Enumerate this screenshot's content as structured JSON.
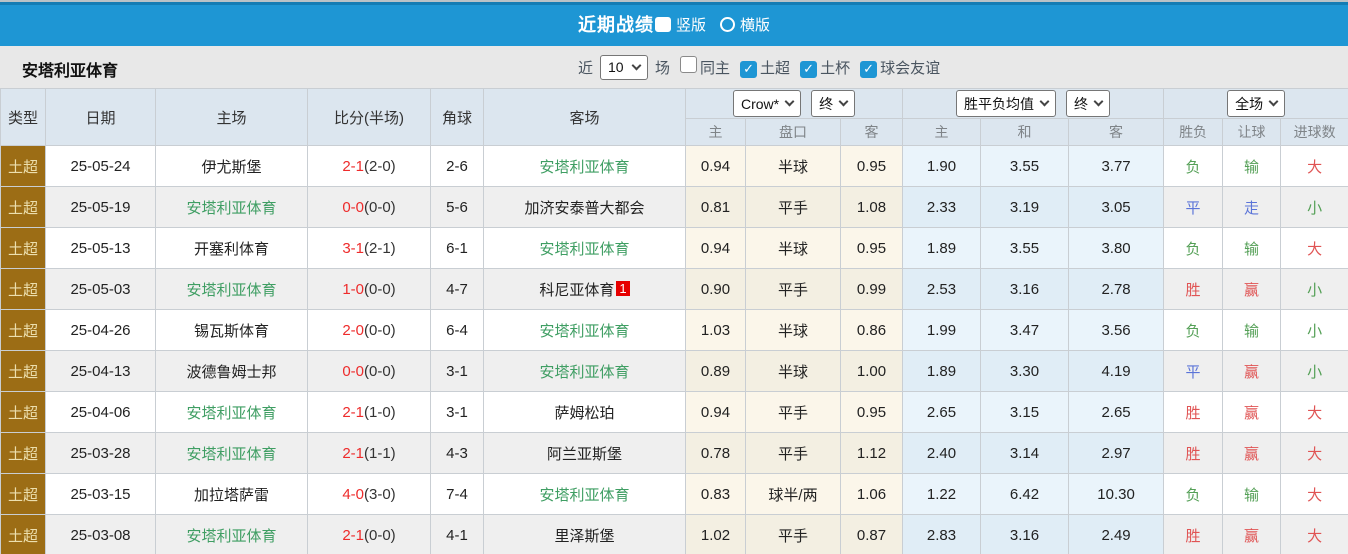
{
  "title_bar": {
    "title": "近期战绩",
    "radio_vertical": "竖版",
    "radio_horizontal": "横版"
  },
  "filter_bar": {
    "team_name": "安塔利亚体育",
    "near_label": "近",
    "match_count": "10",
    "games_label": "场",
    "checkboxes": [
      {
        "label": "同主",
        "checked": false
      },
      {
        "label": "土超",
        "checked": true
      },
      {
        "label": "土杯",
        "checked": true
      },
      {
        "label": "球会友谊",
        "checked": true
      }
    ]
  },
  "icons": {
    "checkmark": "✓",
    "chevron_down": "chevron-down"
  },
  "colors": {
    "accent_blue": "#1e96d4",
    "type_cell_bg": "#9c6d15",
    "team_green": "#3f9e63",
    "score_red": "#ee2b2b",
    "win_red": "#e05454",
    "draw_blue": "#5b74d8",
    "loss_green": "#55a057",
    "badge_red": "#e60000"
  },
  "table": {
    "static_headers": [
      "类型",
      "日期",
      "主场",
      "比分(半场)",
      "角球",
      "客场"
    ],
    "group1": {
      "select1": "Crow*",
      "select2": "终",
      "subheaders": [
        "主",
        "盘口",
        "客"
      ]
    },
    "group2": {
      "select1": "胜平负均值",
      "select2": "终",
      "subheaders": [
        "主",
        "和",
        "客"
      ]
    },
    "group3": {
      "select": "全场",
      "subheaders": [
        "胜负",
        "让球",
        "进球数"
      ]
    },
    "rows": [
      {
        "type": "土超",
        "date": "25-05-24",
        "home": "伊尤斯堡",
        "score_ft": "2-1",
        "score_ht": "(2-0)",
        "corner": "2-6",
        "away": "安塔利亚体育",
        "away_badge": "",
        "asian": [
          "0.94",
          "半球",
          "0.95"
        ],
        "euro": [
          "1.90",
          "3.55",
          "3.77"
        ],
        "results": [
          {
            "t": "负",
            "c": "green"
          },
          {
            "t": "输",
            "c": "green"
          },
          {
            "t": "大",
            "c": "red"
          }
        ]
      },
      {
        "type": "土超",
        "date": "25-05-19",
        "home": "安塔利亚体育",
        "score_ft": "0-0",
        "score_ht": "(0-0)",
        "corner": "5-6",
        "away": "加济安泰普大都会",
        "away_badge": "",
        "asian": [
          "0.81",
          "平手",
          "1.08"
        ],
        "euro": [
          "2.33",
          "3.19",
          "3.05"
        ],
        "results": [
          {
            "t": "平",
            "c": "blue"
          },
          {
            "t": "走",
            "c": "blue"
          },
          {
            "t": "小",
            "c": "green"
          }
        ]
      },
      {
        "type": "土超",
        "date": "25-05-13",
        "home": "开塞利体育",
        "score_ft": "3-1",
        "score_ht": "(2-1)",
        "corner": "6-1",
        "away": "安塔利亚体育",
        "away_badge": "",
        "asian": [
          "0.94",
          "半球",
          "0.95"
        ],
        "euro": [
          "1.89",
          "3.55",
          "3.80"
        ],
        "results": [
          {
            "t": "负",
            "c": "green"
          },
          {
            "t": "输",
            "c": "green"
          },
          {
            "t": "大",
            "c": "red"
          }
        ]
      },
      {
        "type": "土超",
        "date": "25-05-03",
        "home": "安塔利亚体育",
        "score_ft": "1-0",
        "score_ht": "(0-0)",
        "corner": "4-7",
        "away": "科尼亚体育",
        "away_badge": "1",
        "asian": [
          "0.90",
          "平手",
          "0.99"
        ],
        "euro": [
          "2.53",
          "3.16",
          "2.78"
        ],
        "results": [
          {
            "t": "胜",
            "c": "red"
          },
          {
            "t": "赢",
            "c": "red"
          },
          {
            "t": "小",
            "c": "green"
          }
        ]
      },
      {
        "type": "土超",
        "date": "25-04-26",
        "home": "锡瓦斯体育",
        "score_ft": "2-0",
        "score_ht": "(0-0)",
        "corner": "6-4",
        "away": "安塔利亚体育",
        "away_badge": "",
        "asian": [
          "1.03",
          "半球",
          "0.86"
        ],
        "euro": [
          "1.99",
          "3.47",
          "3.56"
        ],
        "results": [
          {
            "t": "负",
            "c": "green"
          },
          {
            "t": "输",
            "c": "green"
          },
          {
            "t": "小",
            "c": "green"
          }
        ]
      },
      {
        "type": "土超",
        "date": "25-04-13",
        "home": "波德鲁姆士邦",
        "score_ft": "0-0",
        "score_ht": "(0-0)",
        "corner": "3-1",
        "away": "安塔利亚体育",
        "away_badge": "",
        "asian": [
          "0.89",
          "半球",
          "1.00"
        ],
        "euro": [
          "1.89",
          "3.30",
          "4.19"
        ],
        "results": [
          {
            "t": "平",
            "c": "blue"
          },
          {
            "t": "赢",
            "c": "red"
          },
          {
            "t": "小",
            "c": "green"
          }
        ]
      },
      {
        "type": "土超",
        "date": "25-04-06",
        "home": "安塔利亚体育",
        "score_ft": "2-1",
        "score_ht": "(1-0)",
        "corner": "3-1",
        "away": "萨姆松珀",
        "away_badge": "",
        "asian": [
          "0.94",
          "平手",
          "0.95"
        ],
        "euro": [
          "2.65",
          "3.15",
          "2.65"
        ],
        "results": [
          {
            "t": "胜",
            "c": "red"
          },
          {
            "t": "赢",
            "c": "red"
          },
          {
            "t": "大",
            "c": "red"
          }
        ]
      },
      {
        "type": "土超",
        "date": "25-03-28",
        "home": "安塔利亚体育",
        "score_ft": "2-1",
        "score_ht": "(1-1)",
        "corner": "4-3",
        "away": "阿兰亚斯堡",
        "away_badge": "",
        "asian": [
          "0.78",
          "平手",
          "1.12"
        ],
        "euro": [
          "2.40",
          "3.14",
          "2.97"
        ],
        "results": [
          {
            "t": "胜",
            "c": "red"
          },
          {
            "t": "赢",
            "c": "red"
          },
          {
            "t": "大",
            "c": "red"
          }
        ]
      },
      {
        "type": "土超",
        "date": "25-03-15",
        "home": "加拉塔萨雷",
        "score_ft": "4-0",
        "score_ht": "(3-0)",
        "corner": "7-4",
        "away": "安塔利亚体育",
        "away_badge": "",
        "asian": [
          "0.83",
          "球半/两",
          "1.06"
        ],
        "euro": [
          "1.22",
          "6.42",
          "10.30"
        ],
        "results": [
          {
            "t": "负",
            "c": "green"
          },
          {
            "t": "输",
            "c": "green"
          },
          {
            "t": "大",
            "c": "red"
          }
        ]
      },
      {
        "type": "土超",
        "date": "25-03-08",
        "home": "安塔利亚体育",
        "score_ft": "2-1",
        "score_ht": "(0-0)",
        "corner": "4-1",
        "away": "里泽斯堡",
        "away_badge": "",
        "asian": [
          "1.02",
          "平手",
          "0.87"
        ],
        "euro": [
          "2.83",
          "3.16",
          "2.49"
        ],
        "results": [
          {
            "t": "胜",
            "c": "red"
          },
          {
            "t": "赢",
            "c": "red"
          },
          {
            "t": "大",
            "c": "red"
          }
        ]
      }
    ]
  }
}
